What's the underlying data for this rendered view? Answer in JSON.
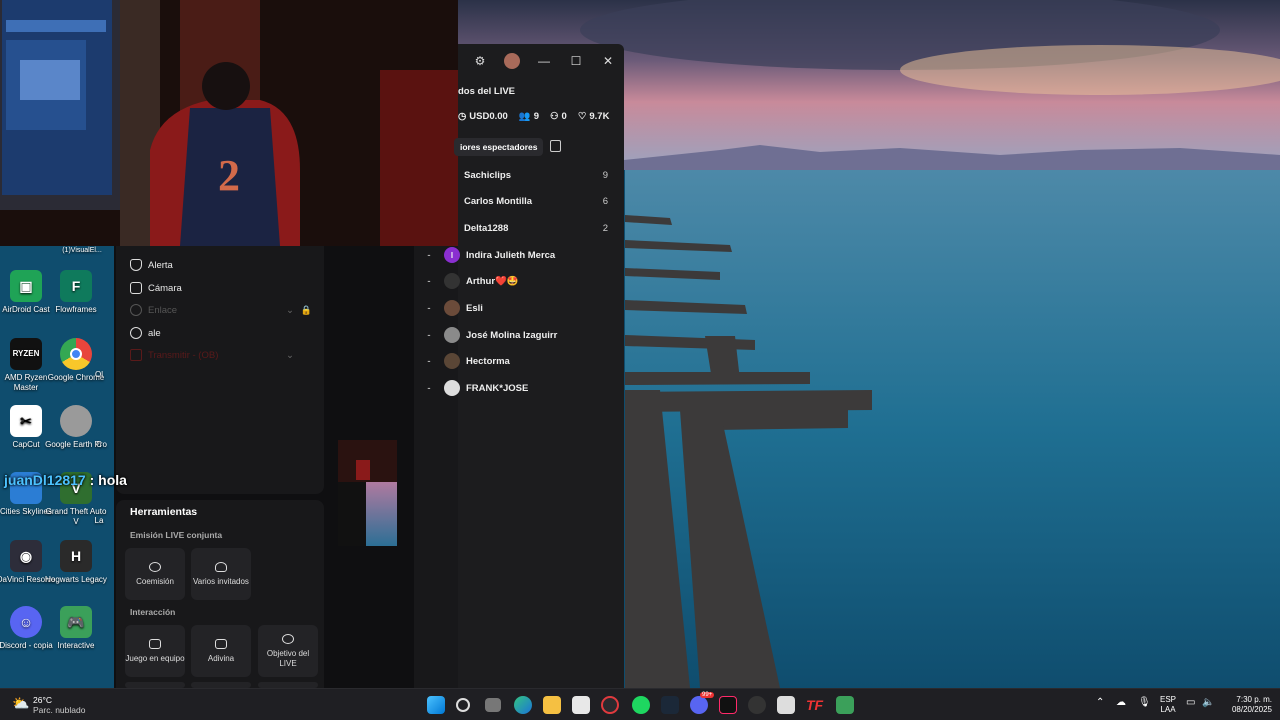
{
  "webcam": {
    "jersey_number": "2"
  },
  "desktop_icons": [
    {
      "label": "AirDroid Cast",
      "icon": "airdroid-icon",
      "color": "#1fa356"
    },
    {
      "label": "Flowframes",
      "icon": "flowframes-icon",
      "color": "#0f7a5c"
    },
    {
      "label": "AMD Ryzen Master",
      "icon": "ryzen-icon",
      "color": "#111111"
    },
    {
      "label": "Google Chrome",
      "icon": "chrome-icon",
      "color": "#e8453c"
    },
    {
      "label": "CapCut",
      "icon": "capcut-icon",
      "color": "#ffffff"
    },
    {
      "label": "Google Earth Pro",
      "icon": "google-earth-icon",
      "color": "#888888"
    },
    {
      "label": "Cities Skylines",
      "icon": "cities-skylines-icon",
      "color": "#2b7dd4"
    },
    {
      "label": "Grand Theft Auto V",
      "icon": "gta-icon",
      "color": "#2f6e2f"
    },
    {
      "label": "DaVinci Resolve",
      "icon": "davinci-icon",
      "color": "#2d2d3a"
    },
    {
      "label": "Hogwarts Legacy",
      "icon": "hogwarts-icon",
      "color": "#2a2a2a"
    },
    {
      "label": "Discord - copia",
      "icon": "discord-icon",
      "color": "#5865f2"
    },
    {
      "label": "Interactive",
      "icon": "gamepad-icon",
      "color": "#3ba05a"
    }
  ],
  "desktop_partial_labels": {
    "top_left": "(1)VisualEl...",
    "right_col_1": "Ol",
    "right_col_2": "La",
    "right_col_3": "C"
  },
  "chat": {
    "user": "juanDl12817",
    "separator": " : ",
    "message": "hola"
  },
  "studio": {
    "menu": [
      {
        "label": "Alerta",
        "icon": "bell-icon",
        "disabled": false
      },
      {
        "label": "Cámara",
        "icon": "camera-icon",
        "disabled": false
      },
      {
        "label": "Enlace",
        "icon": "link-icon",
        "disabled": true
      },
      {
        "label": "ale",
        "icon": "globe-icon",
        "disabled": false
      },
      {
        "label": "Transmitir - (OB)",
        "icon": "broadcast-icon",
        "disabled": true
      }
    ],
    "tools_title": "Herramientas",
    "cohost_section": "Emisión LIVE conjunta",
    "cohost_tiles": [
      "Coemisión",
      "Varios invitados"
    ],
    "interaction_section": "Interacción",
    "interaction_tiles": [
      "Juego en equipo",
      "Adivina",
      "Objetivo del LIVE"
    ]
  },
  "window": {
    "title": "dos del LIVE",
    "stats": {
      "earnings": "USD0.00",
      "viewers": "9",
      "new_followers": "0",
      "likes": "9.7K"
    },
    "tab": "iores espectadores",
    "top_viewers": [
      {
        "name": "Sachiclips",
        "count": "9"
      },
      {
        "name": "Carlos Montilla",
        "count": "6"
      },
      {
        "name": "Delta1288",
        "count": "2"
      }
    ],
    "viewers": [
      {
        "prefix": "-",
        "name": "Indira Julieth Merca",
        "avatar": "#8a2fd0"
      },
      {
        "prefix": "-",
        "name": "Arthur❤️🤩",
        "avatar": "#333333"
      },
      {
        "prefix": "-",
        "name": "Esli",
        "avatar": "#6b4b3a"
      },
      {
        "prefix": "-",
        "name": "José Molina Izaguirr",
        "avatar": "#8a8a8a"
      },
      {
        "prefix": "-",
        "name": "Hectorma",
        "avatar": "#5a4636"
      },
      {
        "prefix": "-",
        "name": "FRANK*JOSE",
        "avatar": "#dddddd"
      }
    ]
  },
  "taskbar": {
    "weather_temp": "26°C",
    "weather_desc": "Parc. nublado",
    "lang_1": "ESP",
    "lang_2": "LAA",
    "time": "7:30 p. m.",
    "date": "08/20/2025",
    "badge": "99+"
  }
}
